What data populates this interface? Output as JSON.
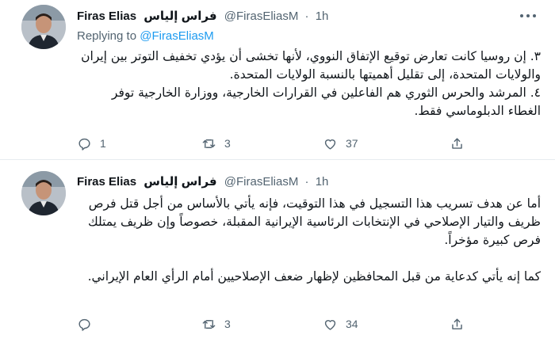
{
  "tweets": [
    {
      "author_name": "Firas Elias",
      "author_name_arabic": "فراس إلياس",
      "handle": "@FirasEliasM",
      "separator": "·",
      "time": "1h",
      "replying_label": "Replying to",
      "replying_to": "@FirasEliasM",
      "text": "٣. إن روسيا كانت تعارض توقيع الإتفاق النووي، لأنها تخشى أن يؤدي تخفيف التوتر بين إيران والولايات المتحدة، إلى تقليل أهميتها بالنسبة الولايات المتحدة.\n٤. المرشد والحرس الثوري هم الفاعلين في القرارات الخارجية، ووزارة الخارجية توفر الغطاء الدبلوماسي فقط.",
      "replies": "1",
      "retweets": "3",
      "likes": "37"
    },
    {
      "author_name": "Firas Elias",
      "author_name_arabic": "فراس إلياس",
      "handle": "@FirasEliasM",
      "separator": "·",
      "time": "1h",
      "text": "أما عن هدف تسريب هذا التسجيل في هذا التوقيت، فإنه يأتي بالأساس من أجل قتل فرص ظريف والتيار الإصلاحي في الإنتخابات الرئاسية الإيرانية المقبلة، خصوصاً وإن ظريف يمتلك فرص كبيرة مؤخراً.\n\nكما إنه يأتي كدعاية من قبل المحافظين لإظهار ضعف الإصلاحيين أمام الرأي العام الإيراني.",
      "replies": "",
      "retweets": "3",
      "likes": "34"
    }
  ],
  "colors": {
    "text": "#0f1419",
    "secondary": "#536471",
    "link": "#1d9bf0",
    "divider": "#e6ecf0"
  },
  "icons": {
    "reply": "reply-icon",
    "retweet": "retweet-icon",
    "like": "heart-icon",
    "share": "share-icon",
    "more": "more-icon"
  }
}
